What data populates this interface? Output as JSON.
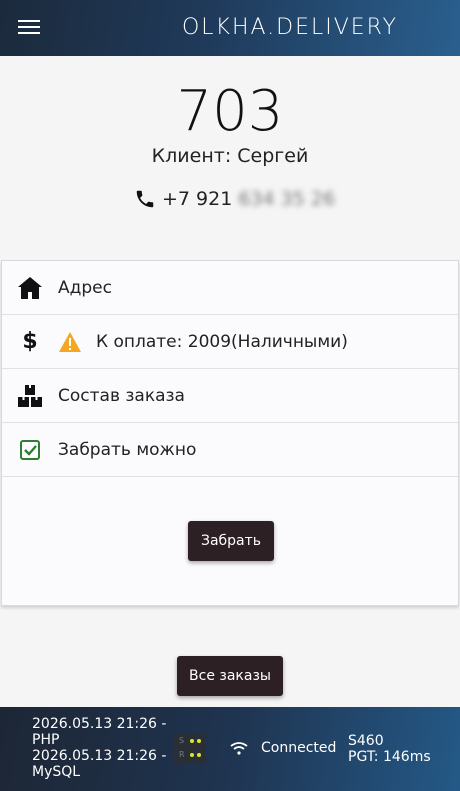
{
  "header": {
    "brand": "OLKHA.DELIVERY",
    "menu_icon": "hamburger-icon"
  },
  "order": {
    "number": "703",
    "client": "Клиент: Сергей",
    "phone_visible": "+7 921",
    "phone_hidden": "634 35 26"
  },
  "details": {
    "address_label": "Адрес",
    "payment_label": "К оплате: 2009(Наличными)",
    "composition_label": "Состав заказа",
    "pickup_label": "Забрать можно",
    "take_button": "Забрать"
  },
  "all_orders_button": "Все заказы",
  "footer": {
    "php_time": "2026.05.13 21:26 -",
    "php_label": "PHP",
    "mysql_time": "2026.05.13 21:26 -",
    "mysql_label": "MySQL",
    "led_s": "S",
    "led_r": "R",
    "status": "Connected",
    "server": "S460",
    "pgt": "PGT: 146ms"
  },
  "colors": {
    "accent_dark": "#2d2025",
    "warning": "#f5a623",
    "check": "#2e7d32"
  }
}
